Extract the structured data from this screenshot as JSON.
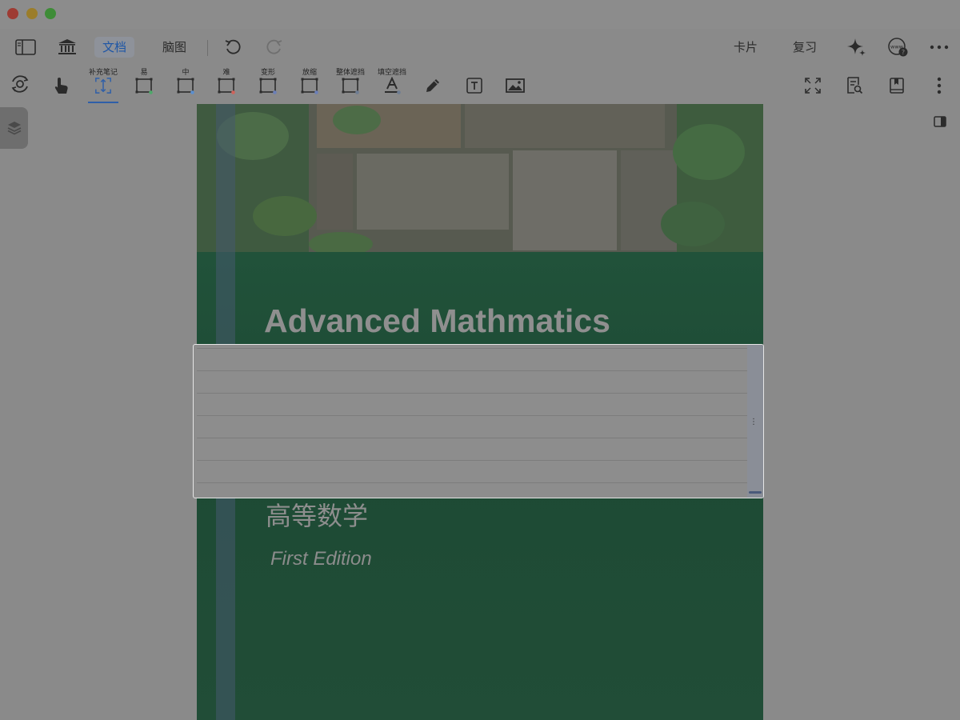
{
  "topbar": {
    "tabs": [
      {
        "label": "文档",
        "active": true
      },
      {
        "label": "脑图",
        "active": false
      }
    ],
    "right": {
      "cards_label": "卡片",
      "review_label": "复习",
      "web_icon_text": "www"
    }
  },
  "annotation_toolbar": {
    "tools": [
      {
        "label": "补充笔记",
        "icon": "add-note-icon"
      },
      {
        "label": "易",
        "icon": "rect-mask-easy-icon"
      },
      {
        "label": "中",
        "icon": "rect-mask-medium-icon"
      },
      {
        "label": "难",
        "icon": "rect-mask-hard-icon"
      },
      {
        "label": "变形",
        "icon": "rect-mask-transform-icon"
      },
      {
        "label": "放缩",
        "icon": "rect-mask-scale-icon"
      },
      {
        "label": "整体遮挡",
        "icon": "rect-mask-whole-icon"
      },
      {
        "label": "填空遮挡",
        "icon": "text-cloze-icon"
      }
    ],
    "tool_dot_colors": {
      "easy": "#4fa86a",
      "medium": "#5b8fcf",
      "hard": "#d0635b",
      "transform": "#6b7fb8",
      "scale": "#6b7fb8",
      "whole": "#6d7c92",
      "cloze": "#6d7c92"
    },
    "active_tool": "补充笔记",
    "accent": "#2f5fa8"
  },
  "document": {
    "cover_title": "Advanced Mathmatics",
    "cover_chinese_title": "高等数学",
    "cover_edition": "First Edition"
  }
}
